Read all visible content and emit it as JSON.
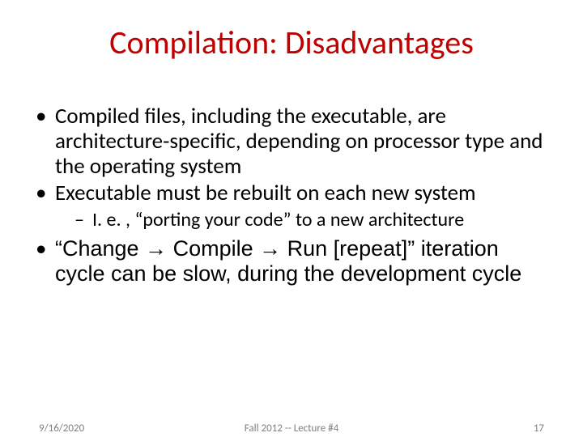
{
  "title": "Compilation: Disadvantages",
  "bullets": {
    "b1": "Compiled files, including the executable, are architecture-specific, depending on processor type and the operating system",
    "b2": "Executable must be rebuilt on each new system",
    "b2_sub1": "I. e. , “porting your code” to a new architecture",
    "b3": "“Change → Compile → Run [repeat]” iteration cycle can be slow, during the development cycle"
  },
  "footer": {
    "left": "9/16/2020",
    "center": "Fall 2012 -- Lecture #4",
    "right": "17"
  }
}
